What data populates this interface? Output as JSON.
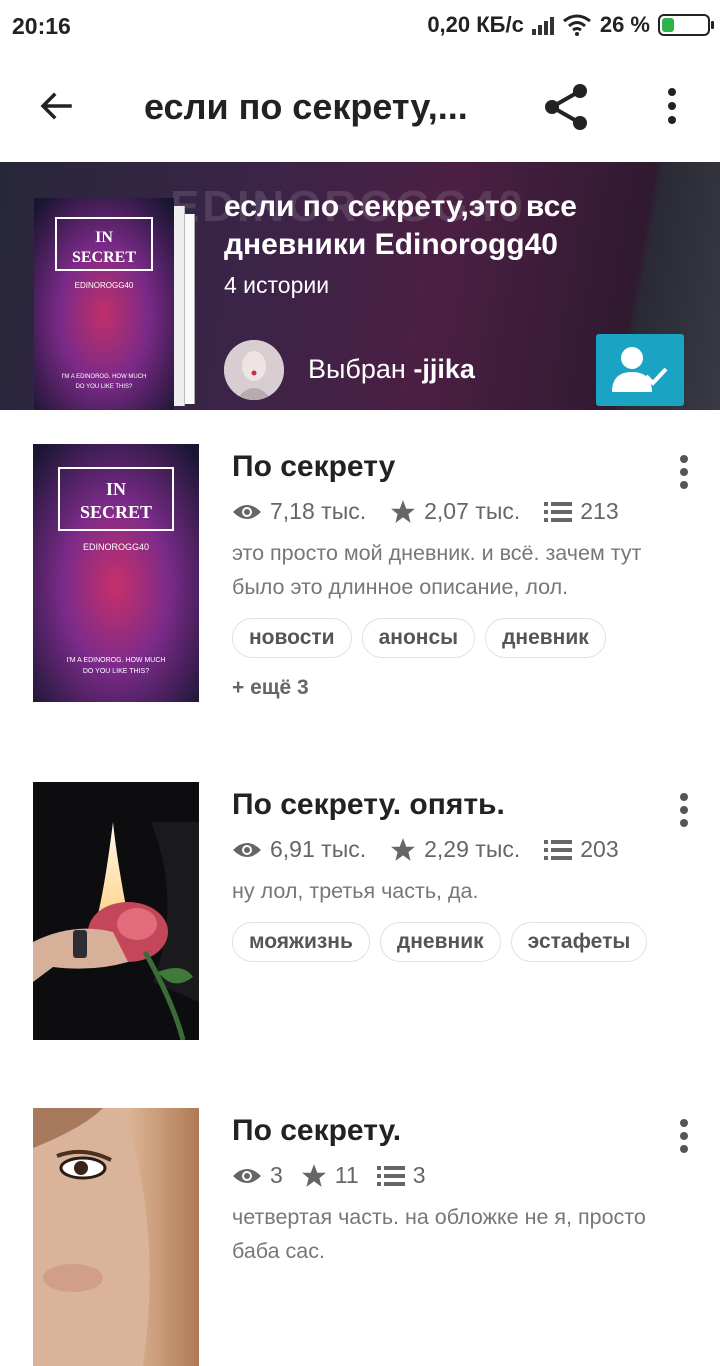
{
  "status_bar": {
    "time": "20:16",
    "network": "0,20 КБ/с",
    "battery": "26 %"
  },
  "app_bar": {
    "title": "если по секрету,..."
  },
  "list_header": {
    "title": "если по секрету,это все дневники Edinorogg40",
    "story_count": "4 истории",
    "chosen_prefix": "Выбран",
    "chosen_by": "-jjika",
    "cover_title_line1": "IN",
    "cover_title_line2": "SECRET",
    "cover_author": "EDINOROGG40",
    "cover_tagline1": "I'M A EDINOROG. HOW MUCH",
    "cover_tagline2": "DO YOU LIKE THIS?",
    "ghost_text": "EDINOROGG40",
    "accent": "#1aa3c2"
  },
  "stories": [
    {
      "title": "По секрету",
      "views": "7,18 тыс.",
      "votes": "2,07 тыс.",
      "parts": "213",
      "description": "это просто мой дневник. и всё. зачем тут было это длинное описание, лол.",
      "tags": [
        "новости",
        "анонсы",
        "дневник"
      ],
      "more_tags": "+ ещё 3"
    },
    {
      "title": "По секрету. опять.",
      "views": "6,91 тыс.",
      "votes": "2,29 тыс.",
      "parts": "203",
      "description": "ну лол, третья часть, да.",
      "tags": [
        "мояжизнь",
        "дневник",
        "эстафеты"
      ]
    },
    {
      "title": "По секрету.",
      "views": "3",
      "votes": "11",
      "parts": "3",
      "description": "четвертая часть. на обложке не я, просто баба сас."
    }
  ]
}
